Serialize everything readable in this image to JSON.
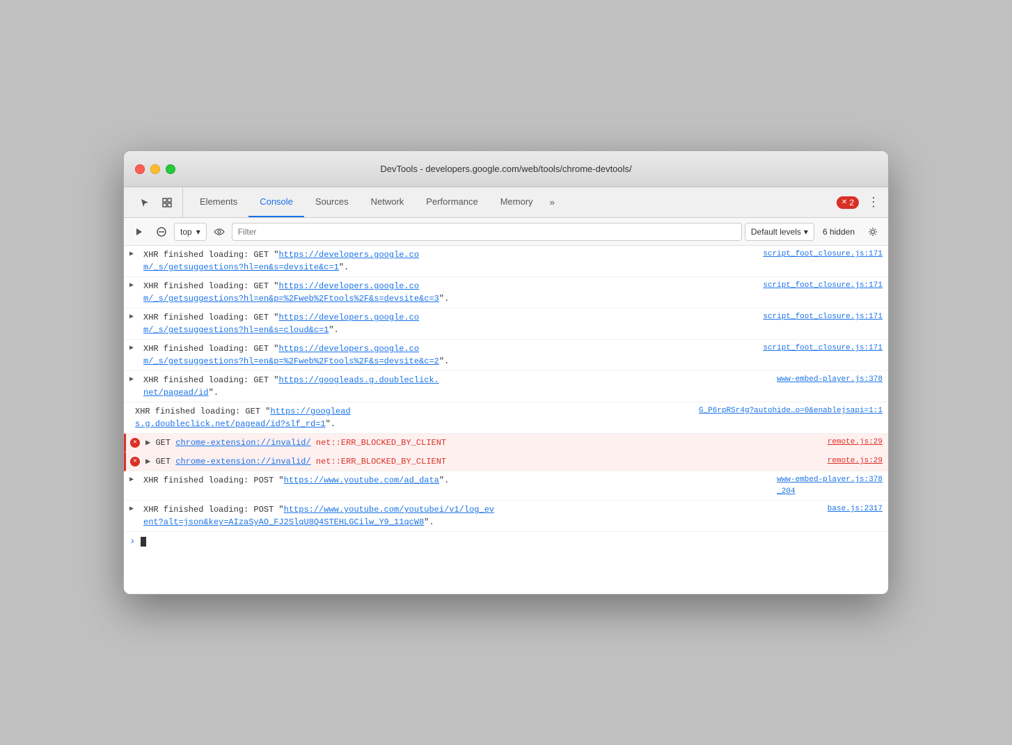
{
  "window": {
    "title": "DevTools - developers.google.com/web/tools/chrome-devtools/"
  },
  "tabs": [
    {
      "id": "elements",
      "label": "Elements",
      "active": false
    },
    {
      "id": "console",
      "label": "Console",
      "active": true
    },
    {
      "id": "sources",
      "label": "Sources",
      "active": false
    },
    {
      "id": "network",
      "label": "Network",
      "active": false
    },
    {
      "id": "performance",
      "label": "Performance",
      "active": false
    },
    {
      "id": "memory",
      "label": "Memory",
      "active": false
    }
  ],
  "error_count": "2",
  "console_toolbar": {
    "context_label": "top",
    "filter_placeholder": "Filter",
    "levels_label": "Default levels",
    "hidden_label": "6 hidden"
  },
  "log_entries": [
    {
      "id": 1,
      "type": "info",
      "has_arrow": true,
      "text_prefix": "XHR finished loading: GET \"",
      "link_text": "https://developers.google.co\nm/_s/getsuggestions?hl=en&s=devsite&c=1",
      "text_suffix": "\".",
      "source": "script_foot_closure.js:171"
    },
    {
      "id": 2,
      "type": "info",
      "has_arrow": true,
      "text_prefix": "XHR finished loading: GET \"",
      "link_text": "https://developers.google.co\nm/_s/getsuggestions?hl=en&p=%2Fweb%2Ftools%2F&s=devsite&c=3",
      "text_suffix": "\".",
      "source": "script_foot_closure.js:171"
    },
    {
      "id": 3,
      "type": "info",
      "has_arrow": true,
      "text_prefix": "XHR finished loading: GET \"",
      "link_text": "https://developers.google.co\nm/_s/getsuggestions?hl=en&s=cloud&c=1",
      "text_suffix": "\".",
      "source": "script_foot_closure.js:171"
    },
    {
      "id": 4,
      "type": "info",
      "has_arrow": true,
      "text_prefix": "XHR finished loading: GET \"",
      "link_text": "https://developers.google.co\nm/_s/getsuggestions?hl=en&p=%2Fweb%2Ftools%2F&s=devsite&c=2",
      "text_suffix": "\".",
      "source": "script_foot_closure.js:171"
    },
    {
      "id": 5,
      "type": "info",
      "has_arrow": true,
      "text_prefix": "XHR finished loading: GET \"",
      "link_text": "https://googleads.g.doubleclick.\nnet/pagead/id",
      "text_suffix": "\".",
      "source": "www-embed-player.js:378"
    },
    {
      "id": 6,
      "type": "info",
      "has_arrow": false,
      "text_prefix": "XHR finished loading: GET \"",
      "link_text": "https://googlead\ns.g.doubleclick.net/pagead/id?slf_rd=1",
      "text_suffix": "\".",
      "source": "G_P6rpRSr4g?autohide…o=0&enablejsapi=1:1"
    },
    {
      "id": 7,
      "type": "error",
      "has_arrow": true,
      "text_prefix": "GET ",
      "link_text": "chrome-extension://invalid/",
      "error_text": " net::ERR_BLOCKED_BY_CLIENT",
      "text_suffix": "",
      "source": "remote.js:29"
    },
    {
      "id": 8,
      "type": "error",
      "has_arrow": true,
      "text_prefix": "GET ",
      "link_text": "chrome-extension://invalid/",
      "error_text": " net::ERR_BLOCKED_BY_CLIENT",
      "text_suffix": "",
      "source": "remote.js:29"
    },
    {
      "id": 9,
      "type": "info",
      "has_arrow": true,
      "text_prefix": "XHR finished loading: POST \"",
      "link_text": "https://www.youtube.com/ad_data",
      "text_suffix": "\".",
      "source": "www-embed-player.js:378\n_204"
    },
    {
      "id": 10,
      "type": "info",
      "has_arrow": true,
      "text_prefix": "XHR finished loading: POST \"",
      "link_text": "https://www.youtube.com/youtubei/v1/log_ev\nent?alt=json&key=AIzaSyAO_FJ2SlqU8Q4STEHLGCilw_Y9_11qcW8",
      "text_suffix": "\".",
      "source": "base.js:2317"
    }
  ]
}
